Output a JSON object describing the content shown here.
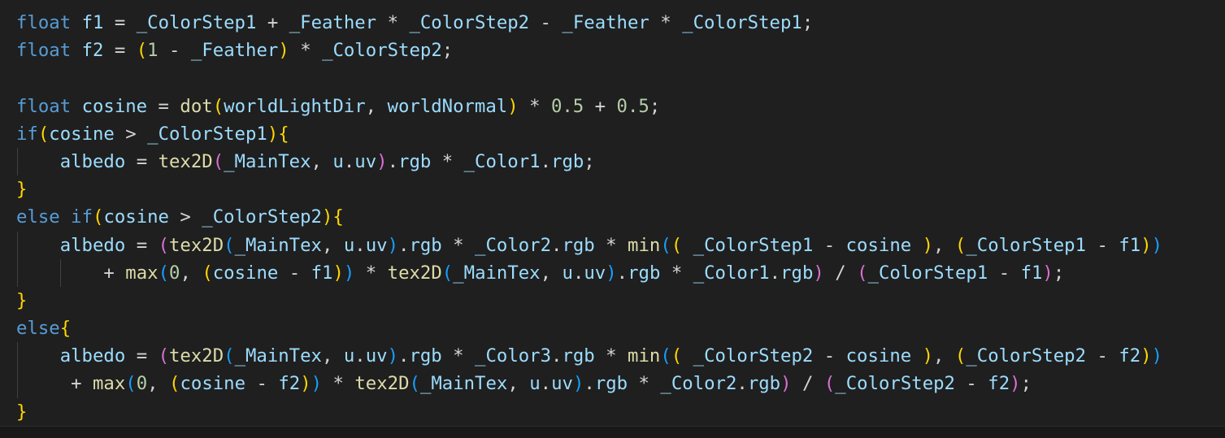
{
  "editor": {
    "language": "hlsl",
    "colors": {
      "background": "#1f1f1f",
      "keyword": "#569cd6",
      "identifier": "#9cdcfe",
      "function": "#dcdcaa",
      "number": "#b5cea8",
      "bracket_level1": "#ffd700",
      "bracket_level2": "#da70d6",
      "bracket_level3": "#179fff",
      "text": "#d4d4d4"
    },
    "lines": [
      "float f1 = _ColorStep1 + _Feather * _ColorStep2 - _Feather * _ColorStep1;",
      "float f2 = (1 - _Feather) * _ColorStep2;",
      "",
      "float cosine = dot(worldLightDir, worldNormal) * 0.5 + 0.5;",
      "if(cosine > _ColorStep1){",
      "    albedo = tex2D(_MainTex, u.uv).rgb * _Color1.rgb;",
      "}",
      "else if(cosine > _ColorStep2){",
      "    albedo = (tex2D(_MainTex, u.uv).rgb * _Color2.rgb * min(( _ColorStep1 - cosine ), (_ColorStep1 - f1))",
      "        + max(0, (cosine - f1)) * tex2D(_MainTex, u.uv).rgb * _Color1.rgb) / (_ColorStep1 - f1);",
      "}",
      "else{",
      "    albedo = (tex2D(_MainTex, u.uv).rgb * _Color3.rgb * min(( _ColorStep2 - cosine ), (_ColorStep2 - f2))",
      "     + max(0, (cosine - f2)) * tex2D(_MainTex, u.uv).rgb * _Color2.rgb) / (_ColorStep2 - f2);",
      "}"
    ]
  }
}
